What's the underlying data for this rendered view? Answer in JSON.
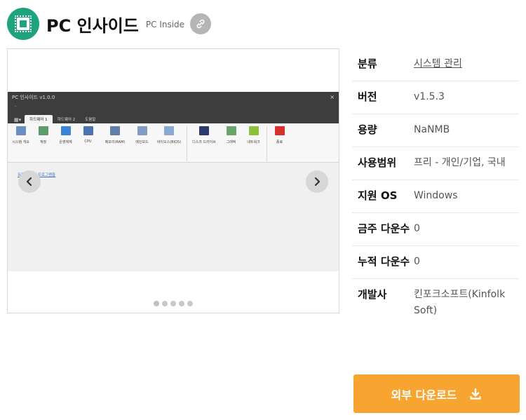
{
  "header": {
    "title": "PC 인사이드",
    "subtitle": "PC Inside",
    "logo_icon": "cpu-chip-icon",
    "link_icon": "link-icon",
    "brand_color": "#1fa37f"
  },
  "carousel": {
    "screenshot": {
      "window_title": "PC 인사이드 v1.0.0",
      "close_glyph": "×",
      "dash": "-",
      "tabs": [
        "하드웨어 1",
        "하드웨어 2",
        "도움말"
      ],
      "ribbon_items": [
        "시스템 개요",
        "계정",
        "운영체제",
        "CPU",
        "메모리(RAM)",
        "메인보드",
        "바이오스(BIOS)",
        "디스크 드라이브",
        "그래픽",
        "네트워크",
        "종료"
      ],
      "body_link": "유용한 무료 프로그램들"
    },
    "prev_icon": "chevron-left-icon",
    "next_icon": "chevron-right-icon",
    "dot_count": 5
  },
  "info": [
    {
      "label": "분류",
      "value": "시스템 관리"
    },
    {
      "label": "버전",
      "value": "v1.5.3"
    },
    {
      "label": "용량",
      "value": "NaNMB"
    },
    {
      "label": "사용범위",
      "value": "프리 - 개인/기업, 국내"
    },
    {
      "label": "지원 OS",
      "value": "Windows"
    },
    {
      "label": "금주 다운수",
      "value": "0"
    },
    {
      "label": "누적 다운수",
      "value": "0"
    },
    {
      "label": "개발사",
      "value": "킨포크소프트(Kinfolk Soft)"
    }
  ],
  "download": {
    "label": "외부 다운로드",
    "icon": "download-icon",
    "color": "#f7a430"
  }
}
